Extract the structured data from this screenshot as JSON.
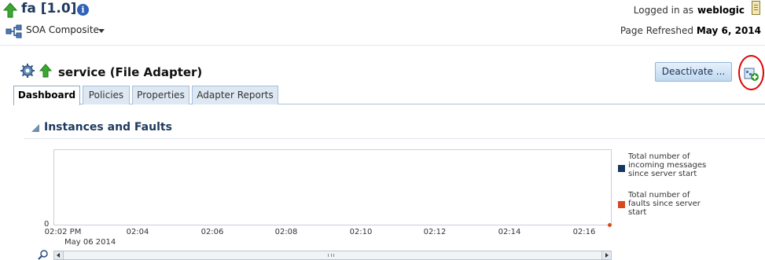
{
  "header": {
    "app_title": "fa [1.0]",
    "logged_in_label": "Logged in as",
    "username": "weblogic",
    "composite_menu": "SOA Composite",
    "refreshed_label": "Page Refreshed",
    "refreshed_date": "May 6, 2014"
  },
  "component": {
    "title": "service (File Adapter)",
    "deactivate_label": "Deactivate ..."
  },
  "tabs": [
    {
      "label": "Dashboard",
      "active": true
    },
    {
      "label": "Policies",
      "active": false
    },
    {
      "label": "Properties",
      "active": false
    },
    {
      "label": "Adapter Reports",
      "active": false
    }
  ],
  "section": {
    "title": "Instances and Faults"
  },
  "chart_data": {
    "type": "line",
    "x": [
      "02:02 PM",
      "02:04",
      "02:06",
      "02:08",
      "02:10",
      "02:12",
      "02:14",
      "02:16"
    ],
    "x_sublabel": "May 06 2014",
    "y_tick_labels": [
      "0"
    ],
    "series": [
      {
        "name": "Total number of incoming messages since server start",
        "color": "#17375e",
        "values": []
      },
      {
        "name": "Total number of faults since server start",
        "color": "#d84a1e",
        "values": [
          0
        ]
      }
    ],
    "legend_placement": "right"
  },
  "colors": {
    "accent": "#1f3a60",
    "highlight_circle": "#e00000"
  },
  "icons": {
    "app_status": "up-arrow-icon",
    "info": "info-icon",
    "composite": "soa-composite-icon",
    "document": "document-icon",
    "component": "service-gear-icon",
    "add": "add-to-dashboard-icon",
    "zoom": "zoom-icon"
  }
}
